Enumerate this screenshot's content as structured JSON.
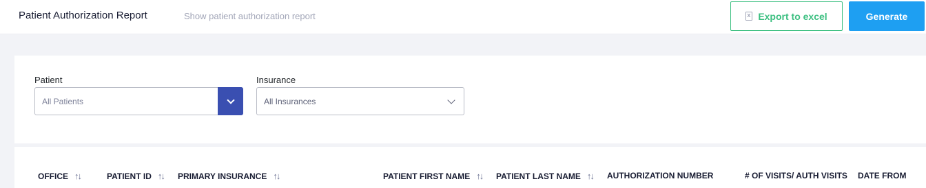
{
  "header": {
    "title": "Patient Authorization Report",
    "subtitle": "Show patient authorization report",
    "export_label": "Export to excel",
    "generate_label": "Generate"
  },
  "filters": {
    "patient": {
      "label": "Patient",
      "value": "All Patients"
    },
    "insurance": {
      "label": "Insurance",
      "value": "All Insurances"
    }
  },
  "table": {
    "columns": [
      {
        "label": "OFFICE",
        "sortable": true
      },
      {
        "label": "PATIENT ID",
        "sortable": true
      },
      {
        "label": "PRIMARY INSURANCE",
        "sortable": true
      },
      {
        "label": "PATIENT FIRST NAME",
        "sortable": true
      },
      {
        "label": "PATIENT LAST NAME",
        "sortable": true
      },
      {
        "label": "AUTHORIZATION NUMBER",
        "sortable": false
      },
      {
        "label": "# OF VISITS/ AUTH VISITS",
        "sortable": false
      },
      {
        "label": "DATE FROM",
        "sortable": false
      }
    ]
  },
  "colors": {
    "accent_blue": "#1e9ff2",
    "dropdown_blue": "#3a4fb1",
    "export_green": "#3bbf80"
  },
  "icons": {
    "export": "excel-file-icon",
    "dropdown": "chevron-down-icon",
    "sort": "sort-arrows-icon"
  }
}
